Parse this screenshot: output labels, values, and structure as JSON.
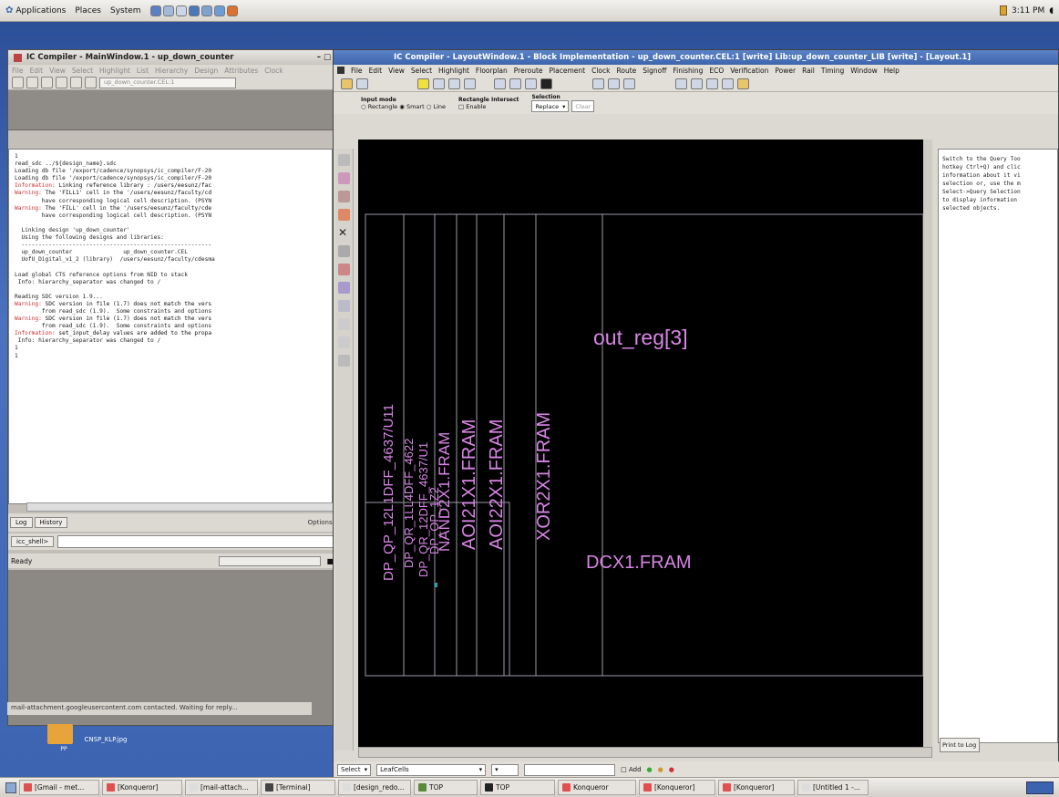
{
  "top_panel": {
    "menus": [
      "Applications",
      "Places",
      "System"
    ],
    "clock": "3:11 PM"
  },
  "main_window": {
    "title": "IC Compiler - MainWindow.1 - up_down_counter",
    "menus": [
      "File",
      "Edit",
      "View",
      "Select",
      "Highlight",
      "List",
      "Hierarchy",
      "Design",
      "Attributes",
      "Clock"
    ],
    "design_combo": "up_down_counter.CEL:1",
    "console_lines": [
      {
        "kind": "normal",
        "text": "1"
      },
      {
        "kind": "normal",
        "text": "read_sdc ../${design_name}.sdc"
      },
      {
        "kind": "normal",
        "text": "Loading db file '/export/cadence/synopsys/ic_compiler/F-20"
      },
      {
        "kind": "normal",
        "text": "Loading db file '/export/cadence/synopsys/ic_compiler/F-20"
      },
      {
        "kind": "info",
        "tag": "Information:",
        "text": " Linking reference library : /users/eesunz/fac"
      },
      {
        "kind": "warn",
        "tag": "Warning:",
        "text": " The 'FILL1' cell in the '/users/eesunz/faculty/cd"
      },
      {
        "kind": "normal",
        "text": "        have corresponding logical cell description. (PSYN"
      },
      {
        "kind": "warn",
        "tag": "Warning:",
        "text": " The 'FILL' cell in the '/users/eesunz/faculty/cde"
      },
      {
        "kind": "normal",
        "text": "        have corresponding logical cell description. (PSYN"
      },
      {
        "kind": "normal",
        "text": ""
      },
      {
        "kind": "normal",
        "text": "  Linking design 'up_down_counter'"
      },
      {
        "kind": "normal",
        "text": "  Using the following designs and libraries:"
      },
      {
        "kind": "normal",
        "text": "  --------------------------------------------------------"
      },
      {
        "kind": "normal",
        "text": "  up_down_counter               up_down_counter.CEL"
      },
      {
        "kind": "normal",
        "text": "  UofU_Digital_v1_2 (library)  /users/eesunz/faculty/cdesma"
      },
      {
        "kind": "normal",
        "text": ""
      },
      {
        "kind": "normal",
        "text": "Load global CTS reference options from NID to stack"
      },
      {
        "kind": "normal",
        "text": " Info: hierarchy_separator was changed to /"
      },
      {
        "kind": "normal",
        "text": ""
      },
      {
        "kind": "normal",
        "text": "Reading SDC version 1.9..."
      },
      {
        "kind": "warn",
        "tag": "Warning:",
        "text": " SDC version in file (1.7) does not match the vers"
      },
      {
        "kind": "normal",
        "text": "        from read_sdc (1.9).  Some constraints and options"
      },
      {
        "kind": "warn",
        "tag": "Warning:",
        "text": " SDC version in file (1.7) does not match the vers"
      },
      {
        "kind": "normal",
        "text": "        from read_sdc (1.9).  Some constraints and options"
      },
      {
        "kind": "info",
        "tag": "Information:",
        "text": " set_input_delay values are added to the propa"
      },
      {
        "kind": "normal",
        "text": " Info: hierarchy_separator was changed to /"
      },
      {
        "kind": "normal",
        "text": "1"
      },
      {
        "kind": "normal",
        "text": "1"
      }
    ],
    "tabs": [
      "Log",
      "History"
    ],
    "options_label": "Options:",
    "shell_prompt": "icc_shell>",
    "status": "Ready"
  },
  "konqueror_status": "mail-attachment.googleusercontent.com contacted. Waiting for reply...",
  "desktop": {
    "folder_label": "PP",
    "image_label": "CNSP_KLP.jpg"
  },
  "layout_window": {
    "title": "IC Compiler - LayoutWindow.1 - Block Implementation - up_down_counter.CEL:1 [write]    Lib:up_down_counter_LIB [write] - [Layout.1]",
    "menus": [
      "File",
      "Edit",
      "View",
      "Select",
      "Highlight",
      "Floorplan",
      "Preroute",
      "Placement",
      "Clock",
      "Route",
      "Signoff",
      "Finishing",
      "ECO",
      "Verification",
      "Power",
      "Rail",
      "Timing",
      "Window",
      "Help"
    ],
    "input_mode": {
      "label": "Input mode",
      "options": [
        "Rectangle",
        "Smart",
        "Line"
      ],
      "selected": "Smart"
    },
    "rect_intersect": {
      "label": "Rectangle Intersect",
      "option": "Enable"
    },
    "selection": {
      "label": "Selection",
      "value": "Replace",
      "clear": "Clear"
    },
    "cells": {
      "out_reg": "out_reg[3]",
      "dcx1": "DCX1.FRAM",
      "xor2x1": "XOR2X1.FRAM",
      "aoi22": "AOI22X1.FRAM",
      "aoi21": "AOI21X1.FRAM",
      "nand": "NAND2X1.FRAM",
      "stack_a": "DP_QP_12L1DFF_4637/U11",
      "stack_b": "DP_QR_1LL4DFF_4622",
      "stack_c": "DP_QR_12DFF_4637/U1",
      "stack_d": "DP_OP_1Z2"
    },
    "query_help": "Switch to the Query Too\nhotkey Ctrl+Q) and clic\ninformation about it vi\nselection or, use the m\nSelect->Query Selection\nto display information \nselected objects.",
    "print_to_log": "Print to Log",
    "bottom": {
      "select": "Select",
      "filter": "LeafCells",
      "add": "Add"
    }
  },
  "taskbar": [
    {
      "label": "[Gmail - met...",
      "color": "#e05050"
    },
    {
      "label": "[Konqueror]",
      "color": "#e05050"
    },
    {
      "label": "[mail-attach...",
      "color": "#dddddd"
    },
    {
      "label": "[Terminal]",
      "color": "#444444"
    },
    {
      "label": "[design_redo...",
      "color": "#dddddd"
    },
    {
      "label": "TOP",
      "color": "#5a8a3a"
    },
    {
      "label": "TOP",
      "color": "#222222"
    },
    {
      "label": "Konqueror",
      "color": "#e05050"
    },
    {
      "label": "[Konqueror]",
      "color": "#e05050"
    },
    {
      "label": "[Konqueror]",
      "color": "#e05050"
    },
    {
      "label": "[Untitled 1 -...",
      "color": "#dddddd"
    }
  ],
  "colors": {
    "canvas": "#000000",
    "cell_label": "#d985e6",
    "cell_outline": "#9a9aa8",
    "warning": "#c83030"
  }
}
